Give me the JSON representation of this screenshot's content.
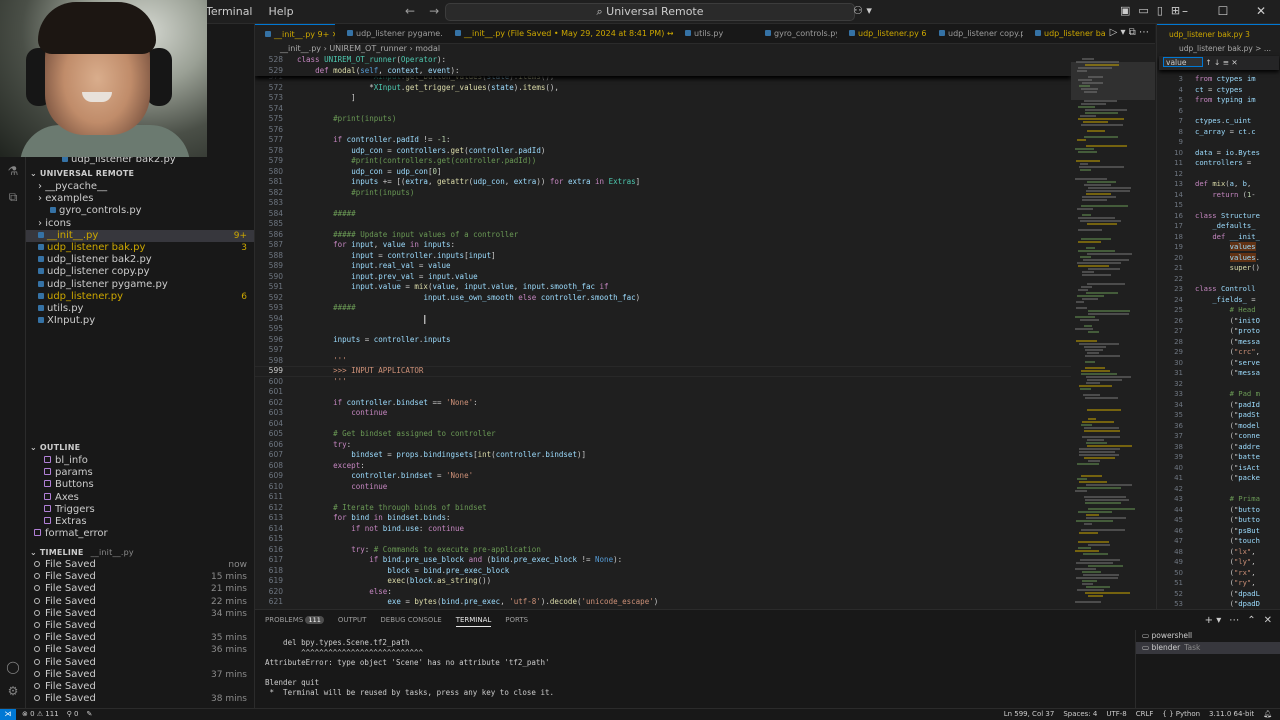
{
  "titlebar": {
    "menu": [
      "Terminal",
      "Help"
    ],
    "search": "Universal Remote",
    "window_controls": [
      "minimize",
      "maximize",
      "close"
    ]
  },
  "sidebar": {
    "top_files": [
      {
        "name": "udp_listener bak2.py"
      }
    ],
    "workspace_title": "UNIVERSAL REMOTE",
    "tree": [
      {
        "label": "__pycache__",
        "type": "folder",
        "indent": 1
      },
      {
        "label": "examples",
        "type": "folder",
        "indent": 1
      },
      {
        "label": "gyro_controls.py",
        "type": "file",
        "indent": 2
      },
      {
        "label": "icons",
        "type": "folder",
        "indent": 1
      },
      {
        "label": "__init__.py",
        "type": "file",
        "indent": 1,
        "badge": "9+",
        "modified": true,
        "selected": true
      },
      {
        "label": "udp_listener bak.py",
        "type": "file",
        "indent": 1,
        "badge": "3",
        "modified": true
      },
      {
        "label": "udp_listener bak2.py",
        "type": "file",
        "indent": 1
      },
      {
        "label": "udp_listener copy.py",
        "type": "file",
        "indent": 1
      },
      {
        "label": "udp_listener pygame.py",
        "type": "file",
        "indent": 1
      },
      {
        "label": "udp_listener.py",
        "type": "file",
        "indent": 1,
        "badge": "6",
        "modified": true
      },
      {
        "label": "utils.py",
        "type": "file",
        "indent": 1
      },
      {
        "label": "XInput.py",
        "type": "file",
        "indent": 1
      }
    ],
    "outline_title": "OUTLINE",
    "outline": [
      {
        "label": "bl_info"
      },
      {
        "label": "params"
      },
      {
        "label": "Buttons"
      },
      {
        "label": "Axes"
      },
      {
        "label": "Triggers"
      },
      {
        "label": "Extras"
      },
      {
        "label": "format_error"
      }
    ],
    "timeline_title": "TIMELINE",
    "timeline_file": "__init__.py",
    "timeline": [
      {
        "label": "File Saved",
        "time": "now"
      },
      {
        "label": "File Saved",
        "time": "15 mins"
      },
      {
        "label": "File Saved",
        "time": "21 mins"
      },
      {
        "label": "File Saved",
        "time": "22 mins"
      },
      {
        "label": "File Saved",
        "time": "34 mins"
      },
      {
        "label": "File Saved",
        "time": ""
      },
      {
        "label": "File Saved",
        "time": "35 mins"
      },
      {
        "label": "File Saved",
        "time": "36 mins"
      },
      {
        "label": "File Saved",
        "time": ""
      },
      {
        "label": "File Saved",
        "time": "37 mins"
      },
      {
        "label": "File Saved",
        "time": ""
      },
      {
        "label": "File Saved",
        "time": "38 mins"
      }
    ]
  },
  "tabs": [
    {
      "label": "__init__.py 9+",
      "active": true,
      "modified": true
    },
    {
      "label": "udp_listener pygame.py"
    },
    {
      "label": "__init__.py (File Saved • May 29, 2024 at 8:41 PM) ↔ __init__.py 9+",
      "modified": true
    },
    {
      "label": "utils.py"
    },
    {
      "label": "gyro_controls.py"
    },
    {
      "label": "udp_listener.py 6",
      "modified": true
    },
    {
      "label": "udp_listener copy.py"
    },
    {
      "label": "udp_listener bak.py",
      "modified": true
    }
  ],
  "breadcrumb": [
    "__init__.py",
    "UNIREM_OT_runner",
    "modal"
  ],
  "editor": {
    "sticky": [
      {
        "ln": "528",
        "code": "class UNIREM_OT_runner(Operator):"
      },
      {
        "ln": "529",
        "code": "    def modal(self, context, event):"
      }
    ],
    "lines": [
      {
        "ln": "571",
        "code": "                *XInput.get_button_values(state).items(),"
      },
      {
        "ln": "572",
        "code": "                *XInput.get_trigger_values(state).items(),"
      },
      {
        "ln": "573",
        "code": "            ]"
      },
      {
        "ln": "574",
        "code": ""
      },
      {
        "ln": "575",
        "code": "        #print(inputs)"
      },
      {
        "ln": "576",
        "code": ""
      },
      {
        "ln": "577",
        "code": "        if controller.padId != -1:"
      },
      {
        "ln": "578",
        "code": "            udp_con = controllers.get(controller.padId)"
      },
      {
        "ln": "579",
        "code": "            #print(controllers.get(controller.padId))"
      },
      {
        "ln": "580",
        "code": "            udp_con = udp_con[0]"
      },
      {
        "ln": "581",
        "code": "            inputs += [(extra, getattr(udp_con, extra)) for extra in Extras]"
      },
      {
        "ln": "582",
        "code": "            #print(inputs)"
      },
      {
        "ln": "583",
        "code": ""
      },
      {
        "ln": "584",
        "code": "        #####"
      },
      {
        "ln": "585",
        "code": ""
      },
      {
        "ln": "586",
        "code": "        ##### Update input values of a controller"
      },
      {
        "ln": "587",
        "code": "        for input, value in inputs:"
      },
      {
        "ln": "588",
        "code": "            input = controller.inputs[input]"
      },
      {
        "ln": "589",
        "code": "            input.real_val = value"
      },
      {
        "ln": "590",
        "code": "            input.prev_val = input.value"
      },
      {
        "ln": "591",
        "code": "            input.value = mix(value, input.value, input.smooth_fac if"
      },
      {
        "ln": "592",
        "code": "                            input.use_own_smooth else controller.smooth_fac)"
      },
      {
        "ln": "593",
        "code": "        #####"
      },
      {
        "ln": "594",
        "code": ""
      },
      {
        "ln": "595",
        "code": ""
      },
      {
        "ln": "596",
        "code": "        inputs = controller.inputs"
      },
      {
        "ln": "597",
        "code": ""
      },
      {
        "ln": "598",
        "code": "        '''"
      },
      {
        "ln": "599",
        "code": "        >>> INPUT APPLICATOR",
        "current": true
      },
      {
        "ln": "600",
        "code": "        '''"
      },
      {
        "ln": "601",
        "code": ""
      },
      {
        "ln": "602",
        "code": "        if controller.bindset == 'None':"
      },
      {
        "ln": "603",
        "code": "            continue"
      },
      {
        "ln": "604",
        "code": ""
      },
      {
        "ln": "605",
        "code": "        # Get bindset assigned to controller"
      },
      {
        "ln": "606",
        "code": "        try:"
      },
      {
        "ln": "607",
        "code": "            bindset = props.bindingsets[int(controller.bindset)]"
      },
      {
        "ln": "608",
        "code": "        except:"
      },
      {
        "ln": "609",
        "code": "            controller.bindset = 'None'"
      },
      {
        "ln": "610",
        "code": "            continue"
      },
      {
        "ln": "611",
        "code": ""
      },
      {
        "ln": "612",
        "code": "        # Iterate through binds of bindset"
      },
      {
        "ln": "613",
        "code": "        for bind in bindset.binds:"
      },
      {
        "ln": "614",
        "code": "            if not bind.use: continue"
      },
      {
        "ln": "615",
        "code": ""
      },
      {
        "ln": "616",
        "code": "            try: # Commands to execute pre-application"
      },
      {
        "ln": "617",
        "code": "                if bind.pre_use_block and (bind.pre_exec_block != None):"
      },
      {
        "ln": "618",
        "code": "                    block = bind.pre_exec_block"
      },
      {
        "ln": "619",
        "code": "                    exec(block.as_string())"
      },
      {
        "ln": "620",
        "code": "                else:"
      },
      {
        "ln": "621",
        "code": "                    exe = bytes(bind.pre_exec, 'utf-8').decode('unicode_escape')"
      }
    ]
  },
  "right_editor": {
    "tab": "udp_listener bak.py 3",
    "breadcrumb": "udp_listener bak.py > ...",
    "find_value": "value",
    "lines": [
      {
        "ln": "3",
        "code": "from ctypes im"
      },
      {
        "ln": "4",
        "code": "ct = ctypes"
      },
      {
        "ln": "5",
        "code": "from typing im"
      },
      {
        "ln": "6",
        "code": ""
      },
      {
        "ln": "7",
        "code": "ctypes.c_uint"
      },
      {
        "ln": "8",
        "code": "c_array = ct.c"
      },
      {
        "ln": "9",
        "code": ""
      },
      {
        "ln": "10",
        "code": "data = io.Bytes"
      },
      {
        "ln": "11",
        "code": "controllers = "
      },
      {
        "ln": "12",
        "code": ""
      },
      {
        "ln": "13",
        "code": "def mix(a, b, "
      },
      {
        "ln": "14",
        "code": "    return (1-"
      },
      {
        "ln": "15",
        "code": ""
      },
      {
        "ln": "16",
        "code": "class Structure"
      },
      {
        "ln": "17",
        "code": "    _defaults_"
      },
      {
        "ln": "18",
        "code": "    def __init_"
      },
      {
        "ln": "19",
        "code": "        values"
      },
      {
        "ln": "20",
        "code": "        values."
      },
      {
        "ln": "21",
        "code": "        super()"
      },
      {
        "ln": "22",
        "code": ""
      },
      {
        "ln": "23",
        "code": "class Controll"
      },
      {
        "ln": "24",
        "code": "    _fields_ ="
      },
      {
        "ln": "25",
        "code": "        # Head"
      },
      {
        "ln": "26",
        "code": "        (\"initO"
      },
      {
        "ln": "27",
        "code": "        (\"proto"
      },
      {
        "ln": "28",
        "code": "        (\"messa"
      },
      {
        "ln": "29",
        "code": "        (\"crc\","
      },
      {
        "ln": "30",
        "code": "        (\"serve"
      },
      {
        "ln": "31",
        "code": "        (\"messa"
      },
      {
        "ln": "32",
        "code": ""
      },
      {
        "ln": "33",
        "code": "        # Pad m"
      },
      {
        "ln": "34",
        "code": "        (\"padId"
      },
      {
        "ln": "35",
        "code": "        (\"padSt"
      },
      {
        "ln": "36",
        "code": "        (\"model"
      },
      {
        "ln": "37",
        "code": "        (\"conne"
      },
      {
        "ln": "38",
        "code": "        (\"addre"
      },
      {
        "ln": "39",
        "code": "        (\"batte"
      },
      {
        "ln": "40",
        "code": "        (\"isAct"
      },
      {
        "ln": "41",
        "code": "        (\"packe"
      },
      {
        "ln": "42",
        "code": ""
      },
      {
        "ln": "43",
        "code": "        # Prima"
      },
      {
        "ln": "44",
        "code": "        (\"butto"
      },
      {
        "ln": "45",
        "code": "        (\"butto"
      },
      {
        "ln": "46",
        "code": "        (\"psBut"
      },
      {
        "ln": "47",
        "code": "        (\"touch"
      },
      {
        "ln": "48",
        "code": "        (\"lx\","
      },
      {
        "ln": "49",
        "code": "        (\"ly\","
      },
      {
        "ln": "50",
        "code": "        (\"rx\","
      },
      {
        "ln": "51",
        "code": "        (\"ry\","
      },
      {
        "ln": "52",
        "code": "        (\"dpadL"
      },
      {
        "ln": "53",
        "code": "        (\"dpadD"
      }
    ]
  },
  "panel": {
    "tabs": [
      "PROBLEMS",
      "OUTPUT",
      "DEBUG CONSOLE",
      "TERMINAL",
      "PORTS"
    ],
    "problems_count": "111",
    "active_tab": "TERMINAL",
    "terminal_lines": [
      "    del bpy.types.Scene.tf2_path",
      "        ^^^^^^^^^^^^^^^^^^^^^^^^^^^",
      "AttributeError: type object 'Scene' has no attribute 'tf2_path'",
      "",
      "Blender quit",
      " *  Terminal will be reused by tasks, press any key to close it."
    ],
    "terminals": [
      {
        "label": "powershell"
      },
      {
        "label": "blender",
        "sub": "Task",
        "selected": true
      }
    ]
  },
  "statusbar": {
    "problems": "0",
    "warnings": "111",
    "position": "Ln 599, Col 37",
    "spaces": "Spaces: 4",
    "encoding": "UTF-8",
    "eol": "CRLF",
    "language": "Python",
    "interpreter": "3.11.0 64-bit"
  },
  "colors": {
    "accent": "#0078d4",
    "modified": "#cca700",
    "background": "#1f1f1f"
  }
}
